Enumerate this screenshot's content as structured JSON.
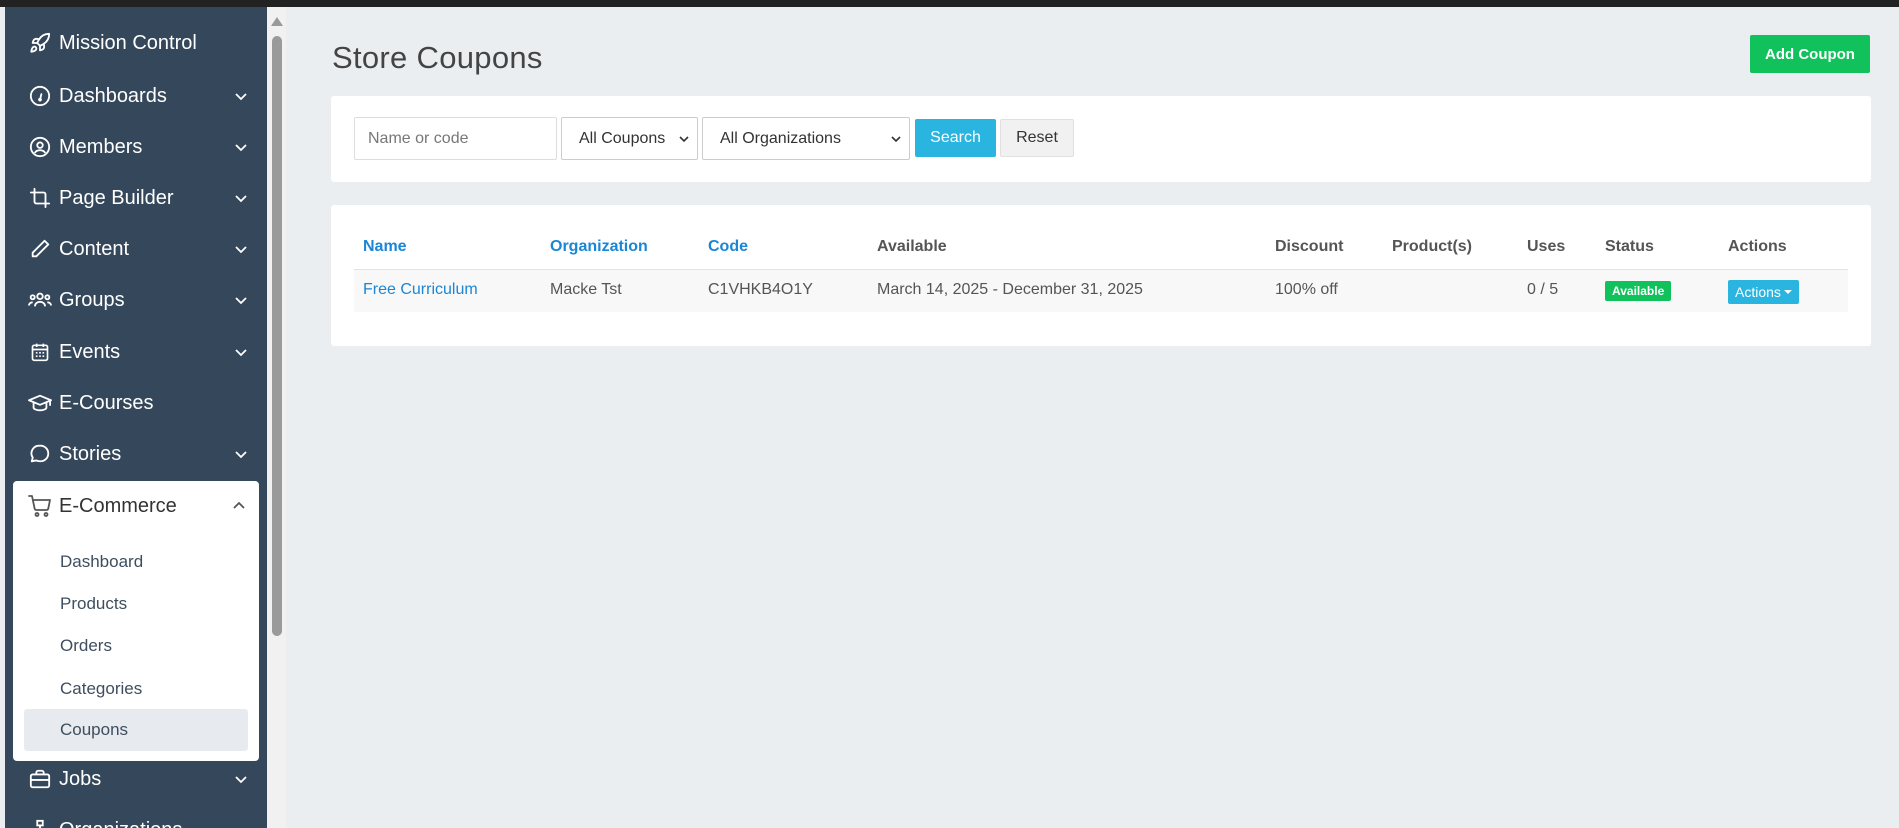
{
  "sidebar": {
    "items": [
      {
        "label": "Mission Control",
        "icon": "rocket-icon",
        "has_chevron": false
      },
      {
        "label": "Dashboards",
        "icon": "gauge-icon",
        "has_chevron": true
      },
      {
        "label": "Members",
        "icon": "user-circle-icon",
        "has_chevron": true
      },
      {
        "label": "Page Builder",
        "icon": "crop-icon",
        "has_chevron": true
      },
      {
        "label": "Content",
        "icon": "pencil-icon",
        "has_chevron": true
      },
      {
        "label": "Groups",
        "icon": "users-icon",
        "has_chevron": true
      },
      {
        "label": "Events",
        "icon": "calendar-icon",
        "has_chevron": true
      },
      {
        "label": "E-Courses",
        "icon": "graduation-cap-icon",
        "has_chevron": false
      },
      {
        "label": "Stories",
        "icon": "chat-bubble-icon",
        "has_chevron": true
      }
    ],
    "ecommerce": {
      "label": "E-Commerce",
      "icon": "cart-icon",
      "sub_items": [
        "Dashboard",
        "Products",
        "Orders",
        "Categories",
        "Coupons"
      ],
      "active": "Coupons"
    },
    "after_items": [
      {
        "label": "Jobs",
        "icon": "briefcase-icon",
        "has_chevron": true
      },
      {
        "label": "Organizations",
        "icon": "sitemap-icon",
        "has_chevron": true
      }
    ]
  },
  "page": {
    "title": "Store Coupons",
    "add_button": "Add Coupon"
  },
  "filters": {
    "search_placeholder": "Name or code",
    "coupon_type": "All Coupons",
    "organization": "All Organizations",
    "search_button": "Search",
    "reset_button": "Reset"
  },
  "table": {
    "headers": [
      "Name",
      "Organization",
      "Code",
      "Available",
      "Discount",
      "Product(s)",
      "Uses",
      "Status",
      "Actions"
    ],
    "rows": [
      {
        "name": "Free Curriculum",
        "organization": "Macke Tst",
        "code": "C1VHKB4O1Y",
        "available": "March 14, 2025 - December 31, 2025",
        "discount": "100% off",
        "products": "",
        "uses": "0 / 5",
        "status": "Available",
        "actions": "Actions"
      }
    ]
  },
  "colors": {
    "sidebar_bg": "#35475a",
    "accent_green": "#11c15b",
    "accent_blue": "#2ab5e1",
    "link_blue": "#1b86d6"
  }
}
